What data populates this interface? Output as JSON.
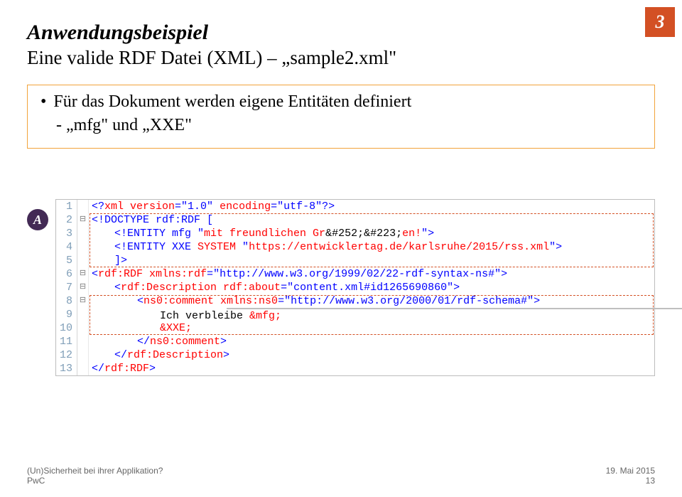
{
  "header": {
    "title": "Anwendungsbeispiel",
    "subtitle": "Eine valide RDF Datei (XML) – „sample2.xml\"",
    "page_badge": "3"
  },
  "content": {
    "bullet": "Für das Dokument werden eigene Entitäten definiert",
    "sub": "- „mfg\" und „XXE\""
  },
  "badge": {
    "label": "A"
  },
  "code_lines": [
    {
      "n": "1",
      "fold": "",
      "segments": [
        {
          "cls": "c-blue",
          "t": "<?"
        },
        {
          "cls": "c-red",
          "t": "xml version"
        },
        {
          "cls": "c-blue",
          "t": "=\"1.0\" "
        },
        {
          "cls": "c-red",
          "t": "encoding"
        },
        {
          "cls": "c-blue",
          "t": "=\"utf-8\"?>"
        }
      ]
    },
    {
      "n": "2",
      "fold": "⊟",
      "segments": [
        {
          "cls": "c-blue",
          "t": "<!DOCTYPE rdf:RDF ["
        }
      ]
    },
    {
      "n": "3",
      "fold": "",
      "indent": 1,
      "segments": [
        {
          "cls": "c-blue",
          "t": "<!ENTITY mfg \""
        },
        {
          "cls": "c-red",
          "t": "mit freundlichen Gr"
        },
        {
          "cls": "c-black",
          "t": "&#252;&#223;"
        },
        {
          "cls": "c-red",
          "t": "en!"
        },
        {
          "cls": "c-blue",
          "t": "\">"
        }
      ]
    },
    {
      "n": "4",
      "fold": "",
      "indent": 1,
      "segments": [
        {
          "cls": "c-blue",
          "t": "<!ENTITY XXE "
        },
        {
          "cls": "c-red",
          "t": "SYSTEM "
        },
        {
          "cls": "c-blue",
          "t": "\""
        },
        {
          "cls": "c-red",
          "t": "https://entwicklertag.de/karlsruhe/2015/rss.xml"
        },
        {
          "cls": "c-blue",
          "t": "\">"
        }
      ]
    },
    {
      "n": "5",
      "fold": "",
      "indent": 1,
      "segments": [
        {
          "cls": "c-blue",
          "t": "]>"
        }
      ]
    },
    {
      "n": "6",
      "fold": "⊟",
      "segments": [
        {
          "cls": "c-blue",
          "t": "<"
        },
        {
          "cls": "c-red",
          "t": "rdf:RDF "
        },
        {
          "cls": "c-red",
          "t": "xmlns:rdf"
        },
        {
          "cls": "c-blue",
          "t": "="
        },
        {
          "cls": "c-blue",
          "t": "\"http://www.w3.org/1999/02/22-rdf-syntax-ns#\""
        },
        {
          "cls": "c-blue",
          "t": ">"
        }
      ]
    },
    {
      "n": "7",
      "fold": "⊟",
      "indent": 1,
      "segments": [
        {
          "cls": "c-blue",
          "t": "<"
        },
        {
          "cls": "c-red",
          "t": "rdf:Description "
        },
        {
          "cls": "c-red",
          "t": "rdf:about"
        },
        {
          "cls": "c-blue",
          "t": "=\"content.xml#id1265690860\""
        },
        {
          "cls": "c-blue",
          "t": ">"
        }
      ]
    },
    {
      "n": "8",
      "fold": "⊟",
      "indent": 2,
      "segments": [
        {
          "cls": "c-blue",
          "t": "<"
        },
        {
          "cls": "c-red",
          "t": "ns0:comment "
        },
        {
          "cls": "c-red",
          "t": "xmlns:ns0"
        },
        {
          "cls": "c-blue",
          "t": "=\"http://www.w3.org/2000/01/rdf-schema#\""
        },
        {
          "cls": "c-blue",
          "t": ">"
        }
      ]
    },
    {
      "n": "9",
      "fold": "",
      "indent": 3,
      "active": true,
      "segments": [
        {
          "cls": "c-black",
          "t": "Ich verbleibe "
        },
        {
          "cls": "c-red",
          "t": "&mfg;"
        }
      ]
    },
    {
      "n": "10",
      "fold": "",
      "indent": 3,
      "segments": [
        {
          "cls": "c-red",
          "t": "&XXE;"
        }
      ]
    },
    {
      "n": "11",
      "fold": "",
      "indent": 2,
      "segments": [
        {
          "cls": "c-blue",
          "t": "</"
        },
        {
          "cls": "c-red",
          "t": "ns0:comment"
        },
        {
          "cls": "c-blue",
          "t": ">"
        }
      ]
    },
    {
      "n": "12",
      "fold": "",
      "indent": 1,
      "segments": [
        {
          "cls": "c-blue",
          "t": "</"
        },
        {
          "cls": "c-red",
          "t": "rdf:Description"
        },
        {
          "cls": "c-blue",
          "t": ">"
        }
      ]
    },
    {
      "n": "13",
      "fold": "",
      "segments": [
        {
          "cls": "c-blue",
          "t": "</"
        },
        {
          "cls": "c-red",
          "t": "rdf:RDF"
        },
        {
          "cls": "c-blue",
          "t": ">"
        }
      ]
    }
  ],
  "footer": {
    "left_line1": "(Un)Sicherheit bei ihrer Applikation?",
    "left_line2": "PwC",
    "right_line1": "19. Mai 2015",
    "right_line2": "13"
  }
}
